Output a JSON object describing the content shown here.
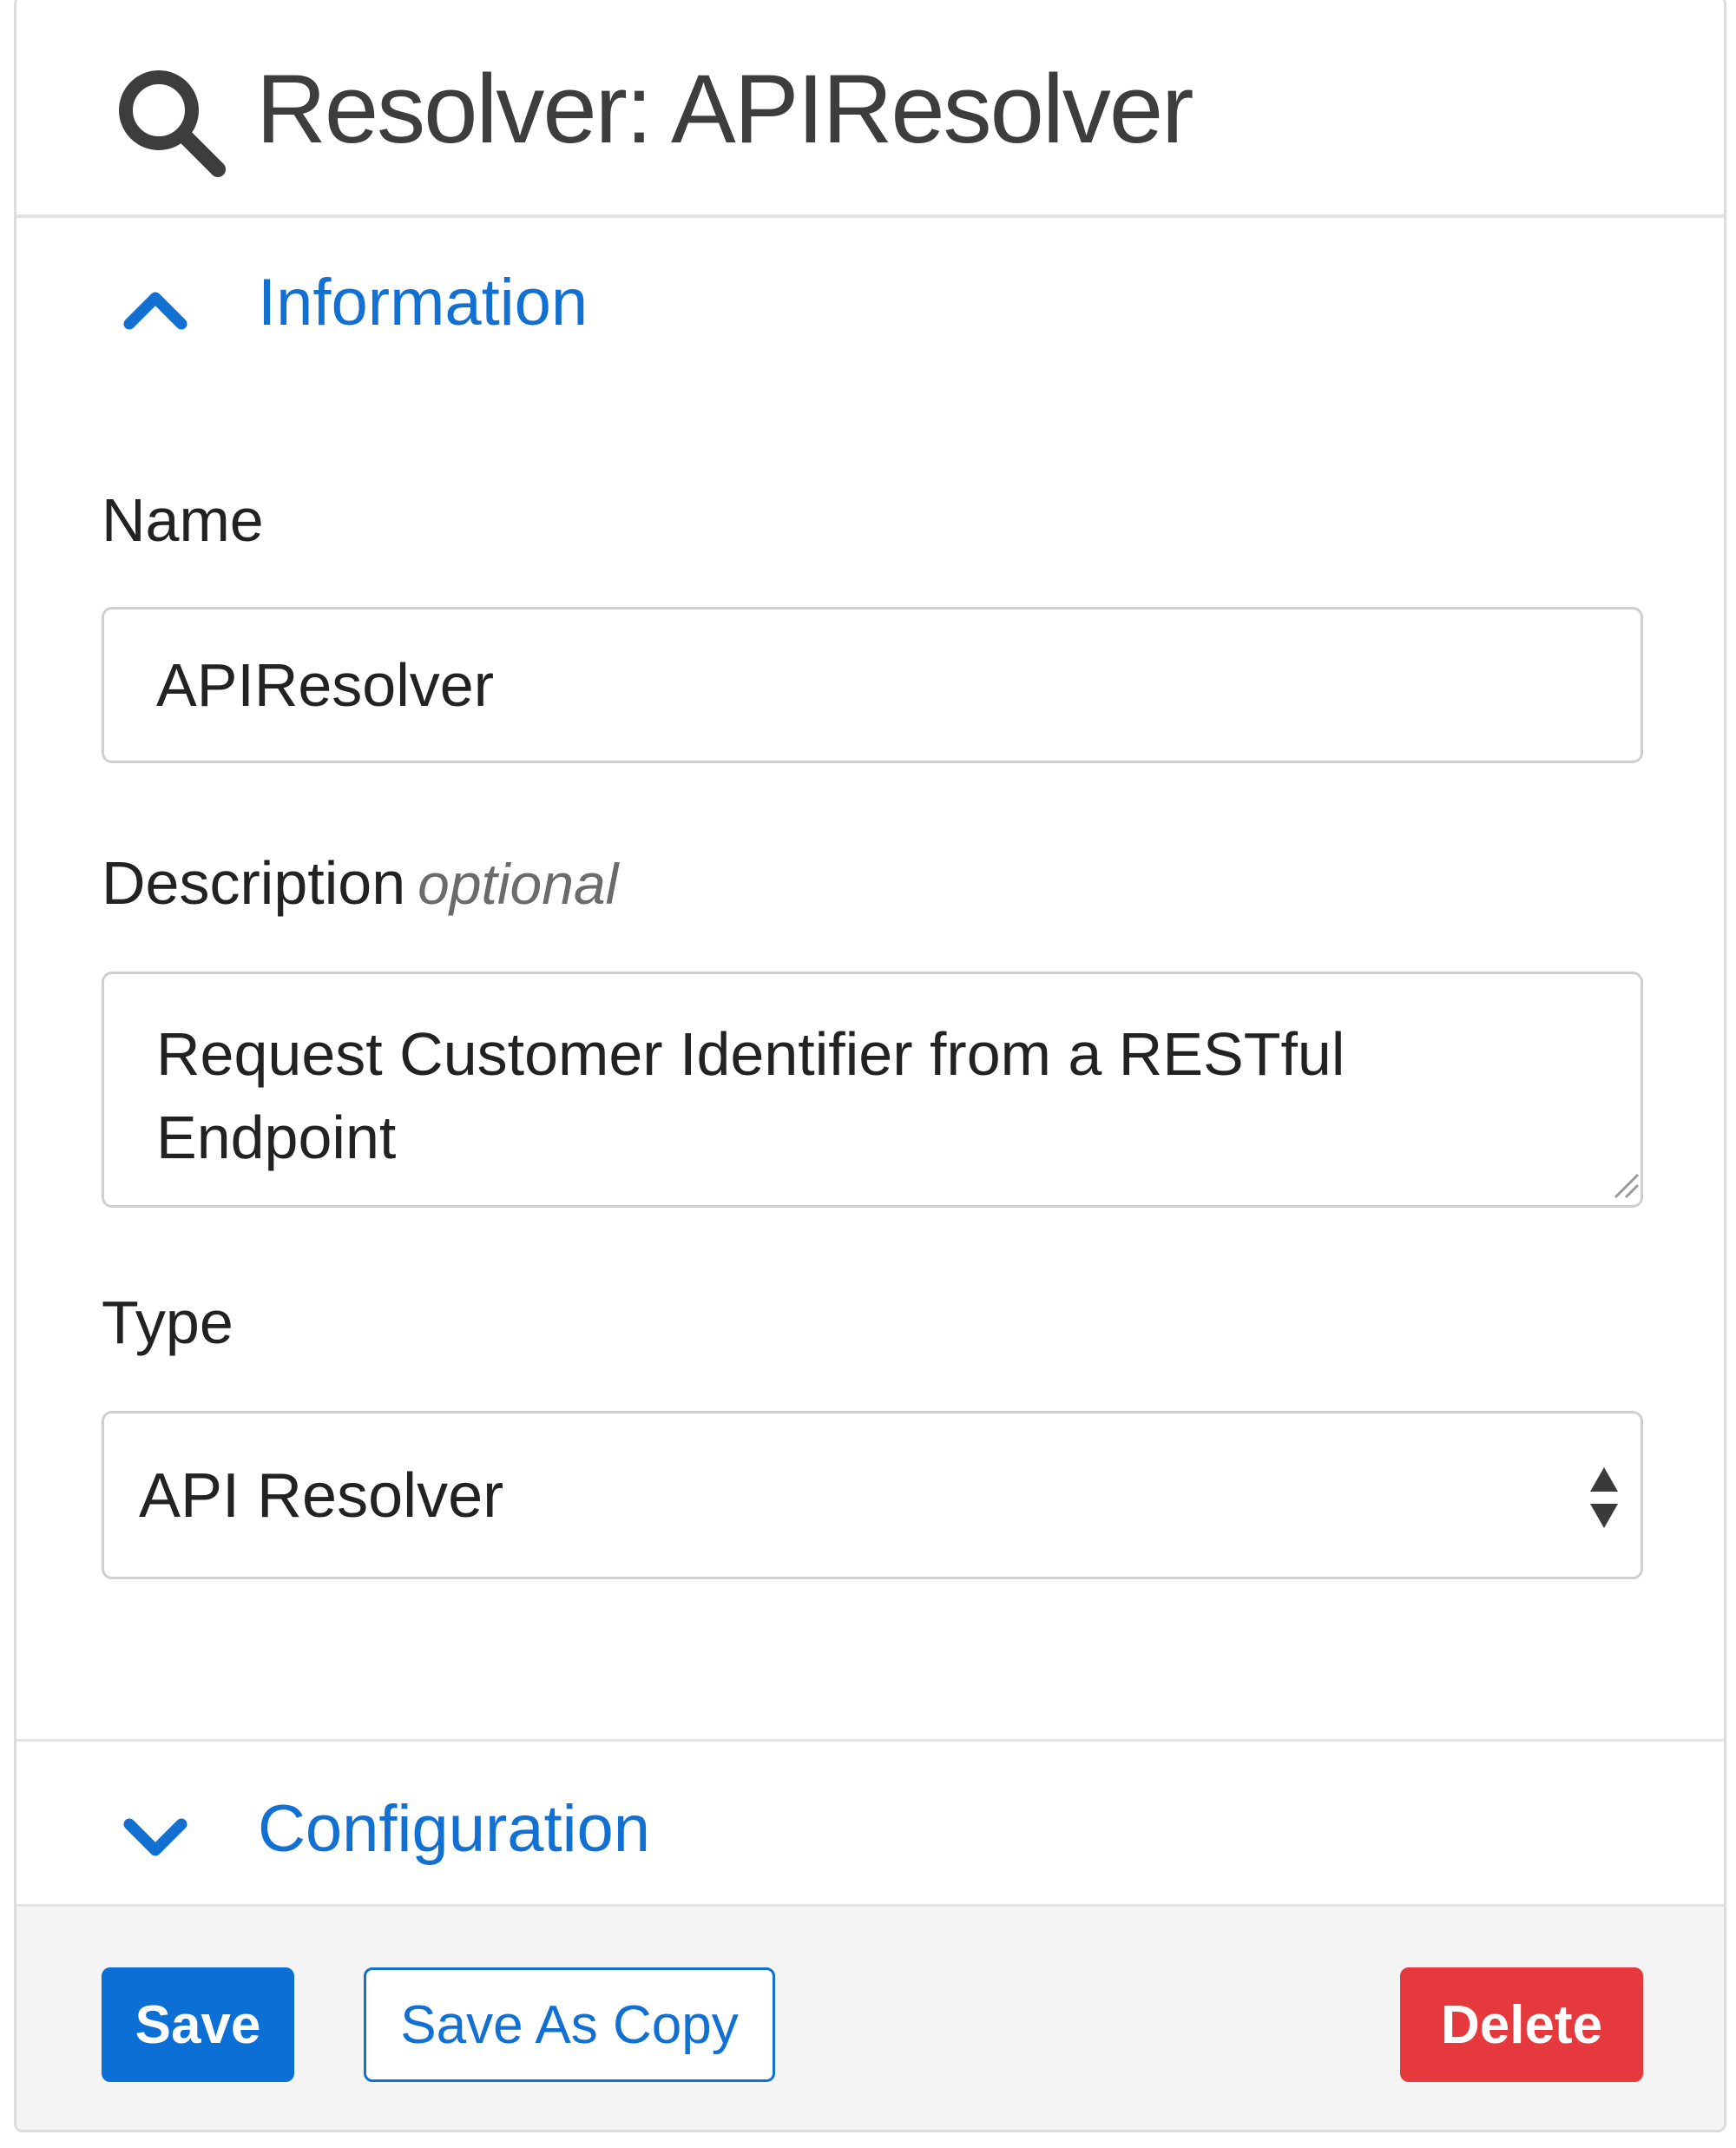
{
  "header": {
    "title": "Resolver: APIResolver",
    "icon": "search-icon"
  },
  "sections": {
    "information": {
      "label": "Information",
      "expanded": true,
      "icon": "chevron-up-icon"
    },
    "configuration": {
      "label": "Configuration",
      "expanded": false,
      "icon": "chevron-down-icon"
    }
  },
  "form": {
    "name": {
      "label": "Name",
      "value": "APIResolver"
    },
    "description": {
      "label": "Description",
      "optional_label": "optional",
      "value": "Request Customer Identifier from a RESTful Endpoint"
    },
    "type": {
      "label": "Type",
      "value": "API Resolver"
    }
  },
  "footer": {
    "save_label": "Save",
    "save_copy_label": "Save As Copy",
    "delete_label": "Delete"
  },
  "colors": {
    "accent": "#1170d2",
    "primary_button": "#0b6fd6",
    "danger_button": "#e5393e",
    "footer_bg": "#f4f4f4"
  }
}
